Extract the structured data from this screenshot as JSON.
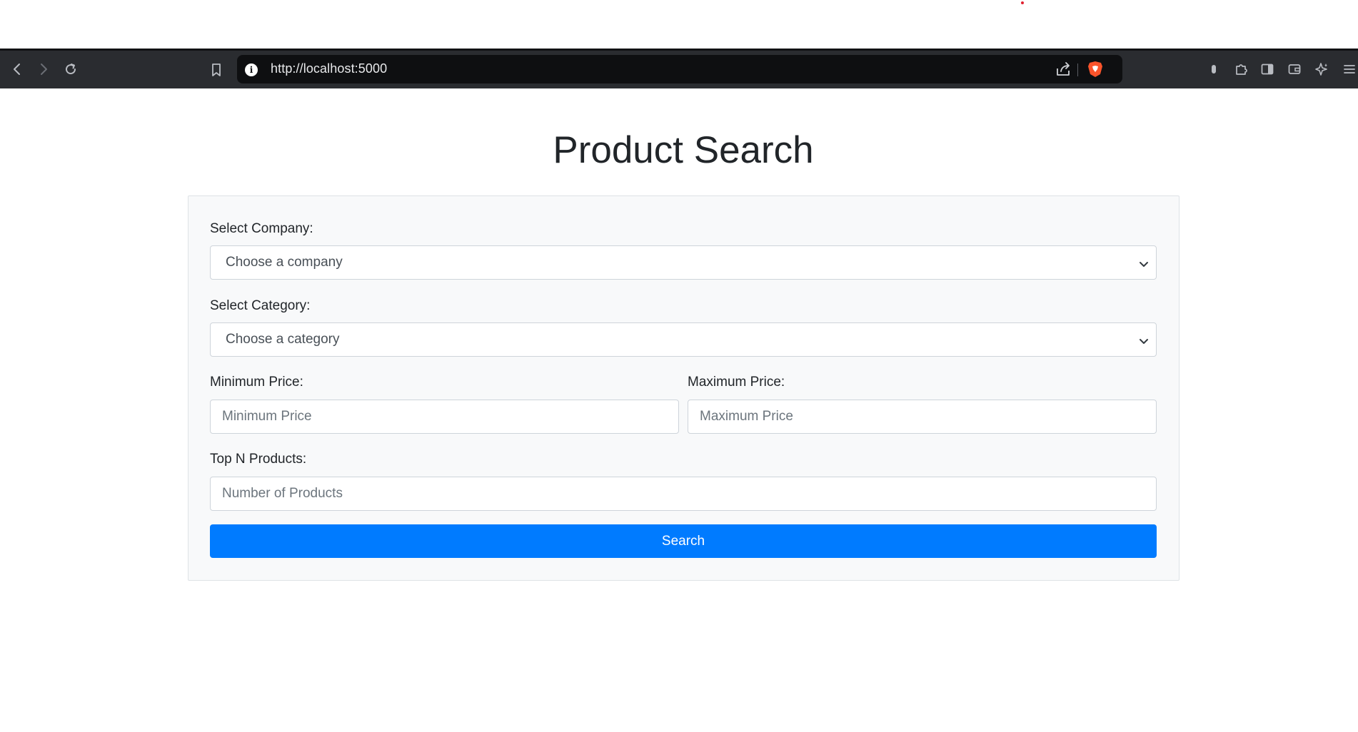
{
  "browser": {
    "url": "http://localhost:5000",
    "info_icon_glyph": "i",
    "icons": [
      "back-icon",
      "forward-icon",
      "reload-icon",
      "bookmark-icon",
      "site-info-icon",
      "share-icon",
      "brave-shield-icon",
      "extension-icon",
      "puzzle-icon",
      "sidebar-icon",
      "wallet-icon",
      "leo-ai-icon",
      "menu-icon"
    ]
  },
  "page": {
    "title": "Product Search"
  },
  "form": {
    "company_label": "Select Company:",
    "company_selected": "Choose a company",
    "category_label": "Select Category:",
    "category_selected": "Choose a category",
    "min_price_label": "Minimum Price:",
    "min_price_placeholder": "Minimum Price",
    "max_price_label": "Maximum Price:",
    "max_price_placeholder": "Maximum Price",
    "top_n_label": "Top N Products:",
    "top_n_placeholder": "Number of Products",
    "search_label": "Search"
  },
  "colors": {
    "toolbar_bg": "#2a2c30",
    "url_bg": "#0e0f11",
    "primary": "#007bff",
    "card_bg": "#f8f9fa",
    "text": "#212529"
  }
}
